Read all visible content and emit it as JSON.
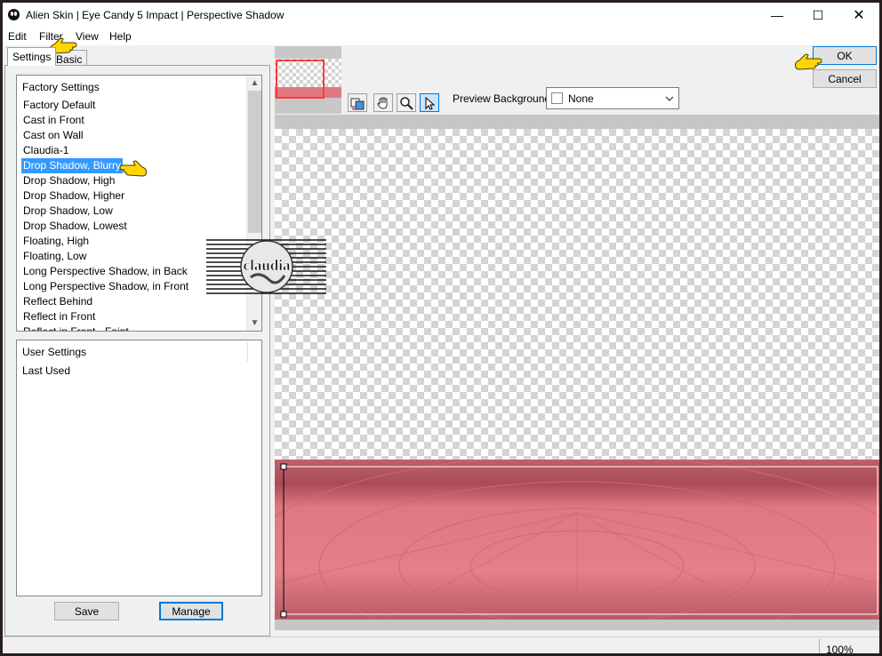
{
  "window": {
    "title": "Alien Skin | Eye Candy 5 Impact | Perspective Shadow",
    "minimize_glyph": "—",
    "maximize_glyph": "☐",
    "close_glyph": "✕"
  },
  "menu": {
    "items": [
      "Edit",
      "Filter",
      "View",
      "Help"
    ]
  },
  "tabs": {
    "settings": "Settings",
    "basic": "Basic"
  },
  "factory_settings": {
    "header": "Factory Settings",
    "items": [
      "Factory Default",
      "Cast in Front",
      "Cast on Wall",
      "Claudia-1",
      "Drop Shadow, Blurry",
      "Drop Shadow, High",
      "Drop Shadow, Higher",
      "Drop Shadow, Low",
      "Drop Shadow, Lowest",
      "Floating, High",
      "Floating, Low",
      "Long Perspective Shadow, in Back",
      "Long Perspective Shadow, in Front",
      "Reflect Behind",
      "Reflect in Front",
      "Reflect in Front - Faint"
    ],
    "selected": "Drop Shadow, Blurry"
  },
  "user_settings": {
    "header": "User Settings",
    "items": [
      "Last Used"
    ]
  },
  "buttons": {
    "save": "Save",
    "manage": "Manage",
    "ok": "OK",
    "cancel": "Cancel"
  },
  "preview_background": {
    "label": "Preview Background:",
    "value": "None"
  },
  "status": {
    "zoom": "100%"
  },
  "watermark": {
    "text": "claudia"
  },
  "icons": {
    "app": "alien-skin-icon",
    "tools": [
      "color-swap-icon",
      "hand-pan-icon",
      "zoom-icon",
      "pointer-arrow-icon"
    ],
    "pointer": "pointing-hand-icon"
  },
  "colors": {
    "selection": "#3399ff",
    "preview_pink": "#e07880",
    "thumb_frame": "#ff3b3b",
    "pointer_yellow": "#ffd700"
  }
}
